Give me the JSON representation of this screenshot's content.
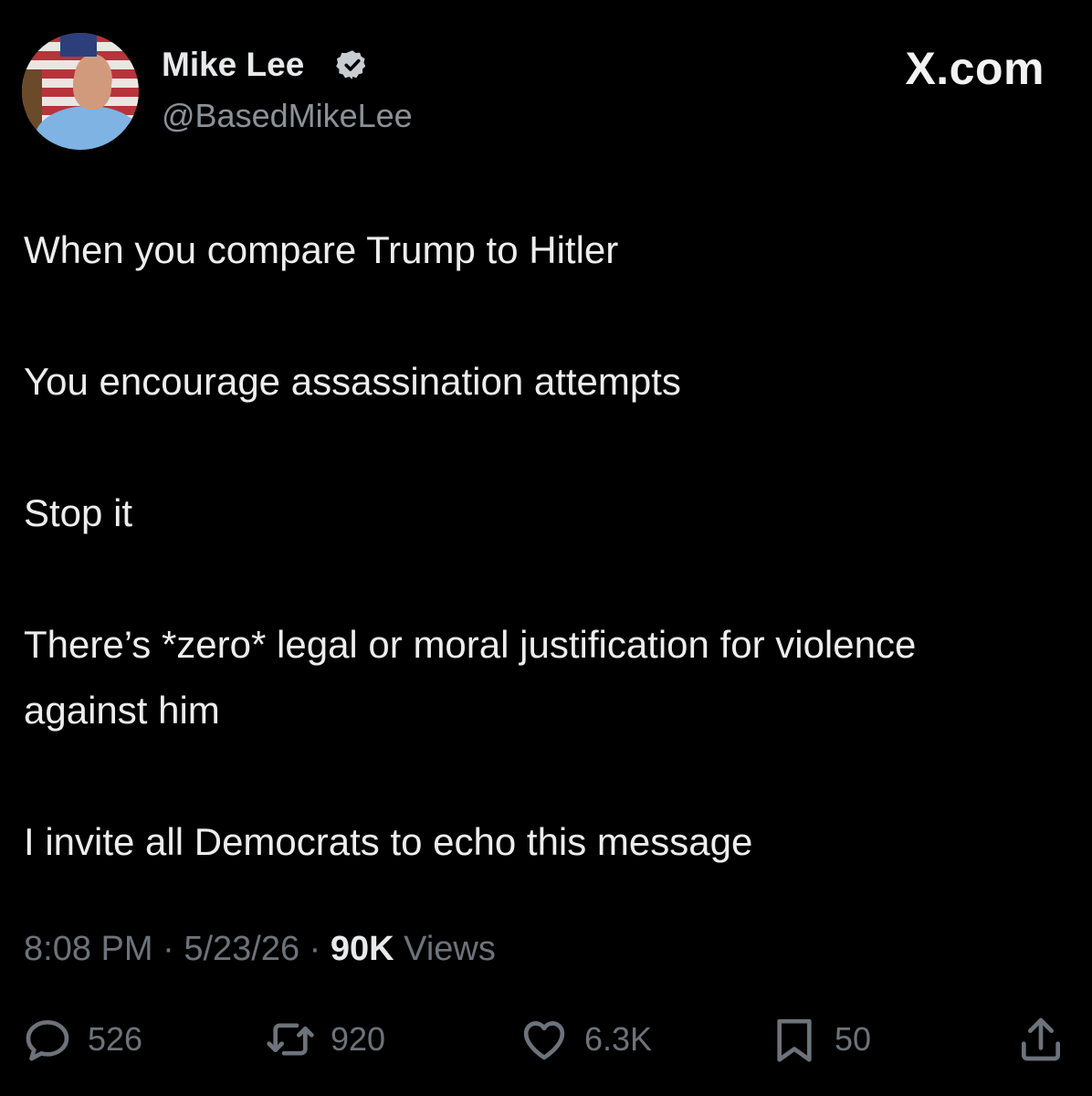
{
  "post": {
    "author_name": "Mike Lee",
    "verified": true,
    "handle": "@BasedMikeLee",
    "brand": "X.com",
    "lines": [
      "When you compare Trump to Hitler",
      "You encourage assassination attempts",
      "Stop it",
      "There’s *zero* legal or moral justification for violence against him",
      "I invite all Democrats to echo this message"
    ],
    "time": "8:08 PM",
    "date": "5/23/26",
    "views_count": "90K",
    "views_label": "Views",
    "separator": "·"
  },
  "actions": {
    "replies": "526",
    "reposts": "920",
    "likes": "6.3K",
    "bookmarks": "50"
  },
  "icons": {
    "reply": "speech-bubble-icon",
    "repost": "repost-icon",
    "like": "heart-icon",
    "bookmark": "bookmark-icon",
    "share": "share-icon",
    "verified": "verified-badge-icon"
  },
  "colors": {
    "background": "#000000",
    "text": "#e7e9ea",
    "muted": "#6d737a",
    "badge": "#c8cdd2"
  }
}
